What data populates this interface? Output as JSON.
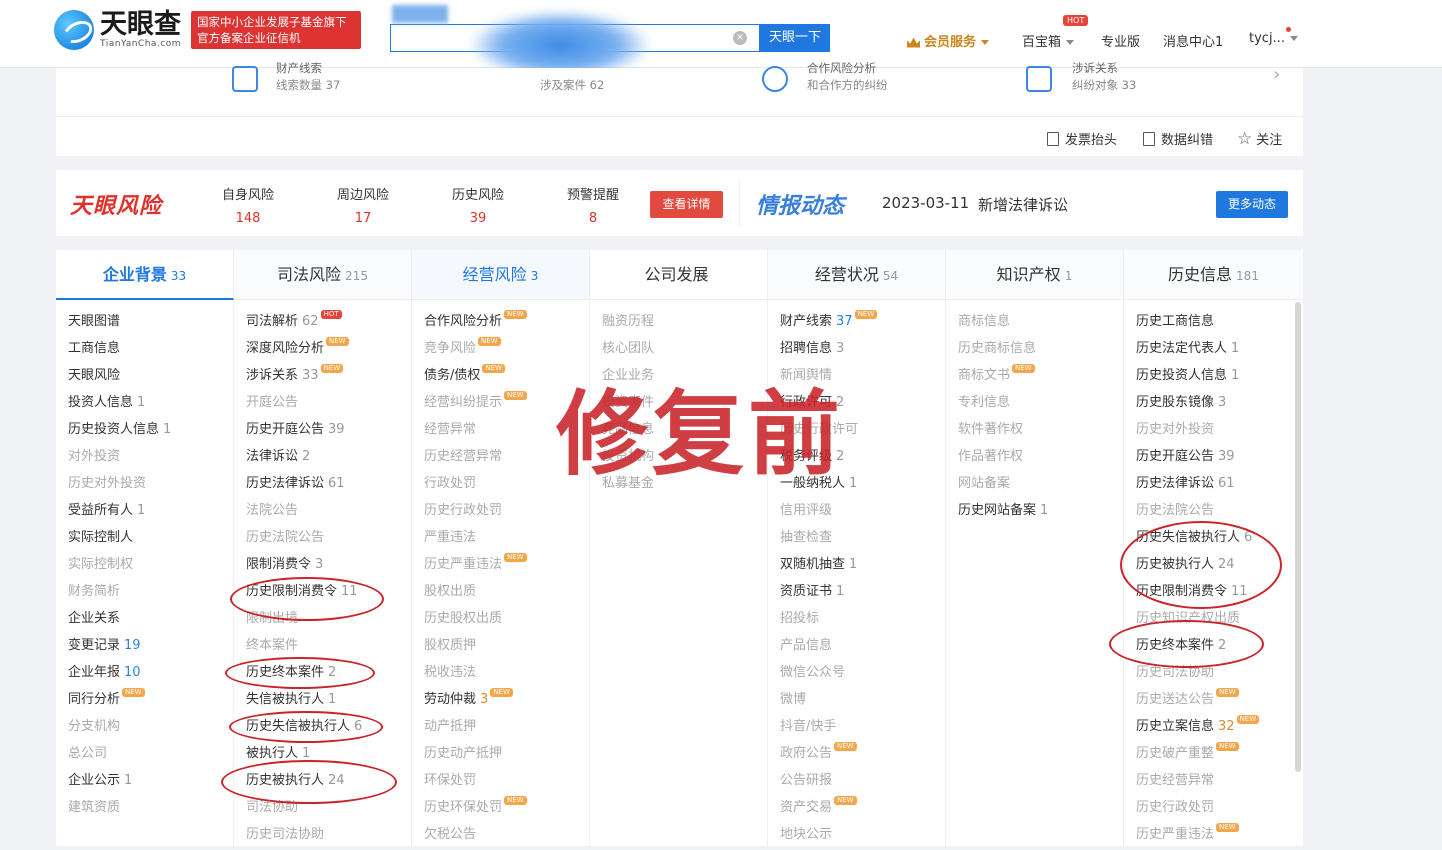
{
  "header": {
    "logo_cn": "天眼查",
    "logo_en": "TianYanCha.com",
    "banner_line1": "国家中小企业发展子基金旗下",
    "banner_line2": "官方备案企业征信机",
    "search_button": "天眼一下",
    "clear_icon": "close-circle-icon",
    "nav": {
      "vip": "会员服务",
      "treasure": "百宝箱",
      "hot": "HOT",
      "pro": "专业版",
      "messages": "消息中心1",
      "user": "tycj..."
    }
  },
  "summary": {
    "stats": [
      {
        "top": "财产线索",
        "text": "线索数量 37"
      },
      {
        "top": "",
        "text": "涉及案件 62"
      },
      {
        "top": "合作风险分析",
        "text": "和合作方的纠纷"
      },
      {
        "top": "涉诉关系",
        "text": "纠纷对象 33"
      }
    ],
    "tools": {
      "invoice": "发票抬头",
      "correction": "数据纠错",
      "follow": "关注"
    }
  },
  "risk": {
    "title": "天眼风险",
    "items": [
      {
        "label": "自身风险",
        "count": "148"
      },
      {
        "label": "周边风险",
        "count": "17"
      },
      {
        "label": "历史风险",
        "count": "39"
      },
      {
        "label": "预警提醒",
        "count": "8"
      }
    ],
    "detail_button": "查看详情",
    "intel_title": "情报动态",
    "intel_date": "2023-03-11",
    "intel_text": "新增法律诉讼",
    "more_button": "更多动态"
  },
  "tabs": [
    {
      "label": "企业背景",
      "count": "33"
    },
    {
      "label": "司法风险",
      "count": "215"
    },
    {
      "label": "经营风险",
      "count": "3"
    },
    {
      "label": "公司发展",
      "count": ""
    },
    {
      "label": "经营状况",
      "count": "54"
    },
    {
      "label": "知识产权",
      "count": "1"
    },
    {
      "label": "历史信息",
      "count": "181"
    }
  ],
  "columns": [
    [
      {
        "l": "天眼图谱"
      },
      {
        "l": "工商信息"
      },
      {
        "l": "天眼风险"
      },
      {
        "l": "投资人信息",
        "n": "1"
      },
      {
        "l": "历史投资人信息",
        "n": "1"
      },
      {
        "l": "对外投资",
        "g": 1
      },
      {
        "l": "历史对外投资",
        "g": 1
      },
      {
        "l": "受益所有人",
        "n": "1"
      },
      {
        "l": "实际控制人"
      },
      {
        "l": "实际控制权",
        "g": 1
      },
      {
        "l": "财务简析",
        "g": 1
      },
      {
        "l": "企业关系"
      },
      {
        "l": "变更记录",
        "n": "19",
        "c": "blue"
      },
      {
        "l": "企业年报",
        "n": "10",
        "c": "blue"
      },
      {
        "l": "同行分析",
        "b": "NEW"
      },
      {
        "l": "分支机构",
        "g": 1
      },
      {
        "l": "总公司",
        "g": 1
      },
      {
        "l": "企业公示",
        "n": "1"
      },
      {
        "l": "建筑资质",
        "g": 1
      }
    ],
    [
      {
        "l": "司法解析",
        "n": "62",
        "b": "HOT"
      },
      {
        "l": "深度风险分析",
        "b": "NEW"
      },
      {
        "l": "涉诉关系",
        "n": "33",
        "b": "NEW"
      },
      {
        "l": "开庭公告",
        "g": 1
      },
      {
        "l": "历史开庭公告",
        "n": "39"
      },
      {
        "l": "法律诉讼",
        "n": "2"
      },
      {
        "l": "历史法律诉讼",
        "n": "61"
      },
      {
        "l": "法院公告",
        "g": 1
      },
      {
        "l": "历史法院公告",
        "g": 1
      },
      {
        "l": "限制消费令",
        "n": "3"
      },
      {
        "l": "历史限制消费令",
        "n": "11"
      },
      {
        "l": "限制出境",
        "g": 1
      },
      {
        "l": "终本案件",
        "g": 1
      },
      {
        "l": "历史终本案件",
        "n": "2"
      },
      {
        "l": "失信被执行人",
        "n": "1"
      },
      {
        "l": "历史失信被执行人",
        "n": "6"
      },
      {
        "l": "被执行人",
        "n": "1"
      },
      {
        "l": "历史被执行人",
        "n": "24"
      },
      {
        "l": "司法协助",
        "g": 1
      },
      {
        "l": "历史司法协助",
        "g": 1
      }
    ],
    [
      {
        "l": "合作风险分析",
        "b": "NEW"
      },
      {
        "l": "竞争风险",
        "g": 1,
        "b": "NEW"
      },
      {
        "l": "债务/债权",
        "b": "NEW"
      },
      {
        "l": "经营纠纷提示",
        "g": 1,
        "b": "NEW"
      },
      {
        "l": "经营异常",
        "g": 1
      },
      {
        "l": "历史经营异常",
        "g": 1
      },
      {
        "l": "行政处罚",
        "g": 1
      },
      {
        "l": "历史行政处罚",
        "g": 1
      },
      {
        "l": "严重违法",
        "g": 1
      },
      {
        "l": "历史严重违法",
        "g": 1,
        "b": "NEW"
      },
      {
        "l": "股权出质",
        "g": 1
      },
      {
        "l": "历史股权出质",
        "g": 1
      },
      {
        "l": "股权质押",
        "g": 1
      },
      {
        "l": "税收违法",
        "g": 1
      },
      {
        "l": "劳动仲裁",
        "n": "3",
        "c": "orange",
        "b": "NEW"
      },
      {
        "l": "动产抵押",
        "g": 1
      },
      {
        "l": "历史动产抵押",
        "g": 1
      },
      {
        "l": "环保处罚",
        "g": 1
      },
      {
        "l": "历史环保处罚",
        "g": 1,
        "b": "NEW"
      },
      {
        "l": "欠税公告",
        "g": 1
      }
    ],
    [
      {
        "l": "融资历程",
        "g": 1
      },
      {
        "l": "核心团队",
        "g": 1
      },
      {
        "l": "企业业务",
        "g": 1
      },
      {
        "l": "投资事件",
        "g": 1
      },
      {
        "l": "竞品信息",
        "g": 1
      },
      {
        "l": "投资机构",
        "g": 1
      },
      {
        "l": "私募基金",
        "g": 1
      }
    ],
    [
      {
        "l": "财产线索",
        "n": "37",
        "c": "blue",
        "b": "NEW"
      },
      {
        "l": "招聘信息",
        "n": "3"
      },
      {
        "l": "新闻舆情",
        "g": 1
      },
      {
        "l": "行政许可",
        "n": "2"
      },
      {
        "l": "历史行政许可",
        "g": 1
      },
      {
        "l": "税务评级",
        "n": "2"
      },
      {
        "l": "一般纳税人",
        "n": "1"
      },
      {
        "l": "信用评级",
        "g": 1
      },
      {
        "l": "抽查检查",
        "g": 1
      },
      {
        "l": "双随机抽查",
        "n": "1"
      },
      {
        "l": "资质证书",
        "n": "1"
      },
      {
        "l": "招投标",
        "g": 1
      },
      {
        "l": "产品信息",
        "g": 1
      },
      {
        "l": "微信公众号",
        "g": 1
      },
      {
        "l": "微博",
        "g": 1
      },
      {
        "l": "抖音/快手",
        "g": 1
      },
      {
        "l": "政府公告",
        "g": 1,
        "b": "NEW"
      },
      {
        "l": "公告研报",
        "g": 1
      },
      {
        "l": "资产交易",
        "g": 1,
        "b": "NEW"
      },
      {
        "l": "地块公示",
        "g": 1
      }
    ],
    [
      {
        "l": "商标信息",
        "g": 1
      },
      {
        "l": "历史商标信息",
        "g": 1
      },
      {
        "l": "商标文书",
        "g": 1,
        "b": "NEW"
      },
      {
        "l": "专利信息",
        "g": 1
      },
      {
        "l": "软件著作权",
        "g": 1
      },
      {
        "l": "作品著作权",
        "g": 1
      },
      {
        "l": "网站备案",
        "g": 1
      },
      {
        "l": "历史网站备案",
        "n": "1"
      }
    ],
    [
      {
        "l": "历史工商信息"
      },
      {
        "l": "历史法定代表人",
        "n": "1"
      },
      {
        "l": "历史投资人信息",
        "n": "1"
      },
      {
        "l": "历史股东镜像",
        "n": "3"
      },
      {
        "l": "历史对外投资",
        "g": 1
      },
      {
        "l": "历史开庭公告",
        "n": "39"
      },
      {
        "l": "历史法律诉讼",
        "n": "61"
      },
      {
        "l": "历史法院公告",
        "g": 1
      },
      {
        "l": "历史失信被执行人",
        "n": "6"
      },
      {
        "l": "历史被执行人",
        "n": "24"
      },
      {
        "l": "历史限制消费令",
        "n": "11"
      },
      {
        "l": "历史知识产权出质",
        "g": 1
      },
      {
        "l": "历史终本案件",
        "n": "2"
      },
      {
        "l": "历史司法协助",
        "g": 1
      },
      {
        "l": "历史送达公告",
        "g": 1,
        "b": "NEW"
      },
      {
        "l": "历史立案信息",
        "n": "32",
        "c": "orange",
        "b": "NEW"
      },
      {
        "l": "历史破产重整",
        "g": 1,
        "b": "NEW"
      },
      {
        "l": "历史经营异常",
        "g": 1
      },
      {
        "l": "历史行政处罚",
        "g": 1
      },
      {
        "l": "历史严重违法",
        "g": 1,
        "b": "NEW"
      }
    ]
  ],
  "stamp": "修复前"
}
